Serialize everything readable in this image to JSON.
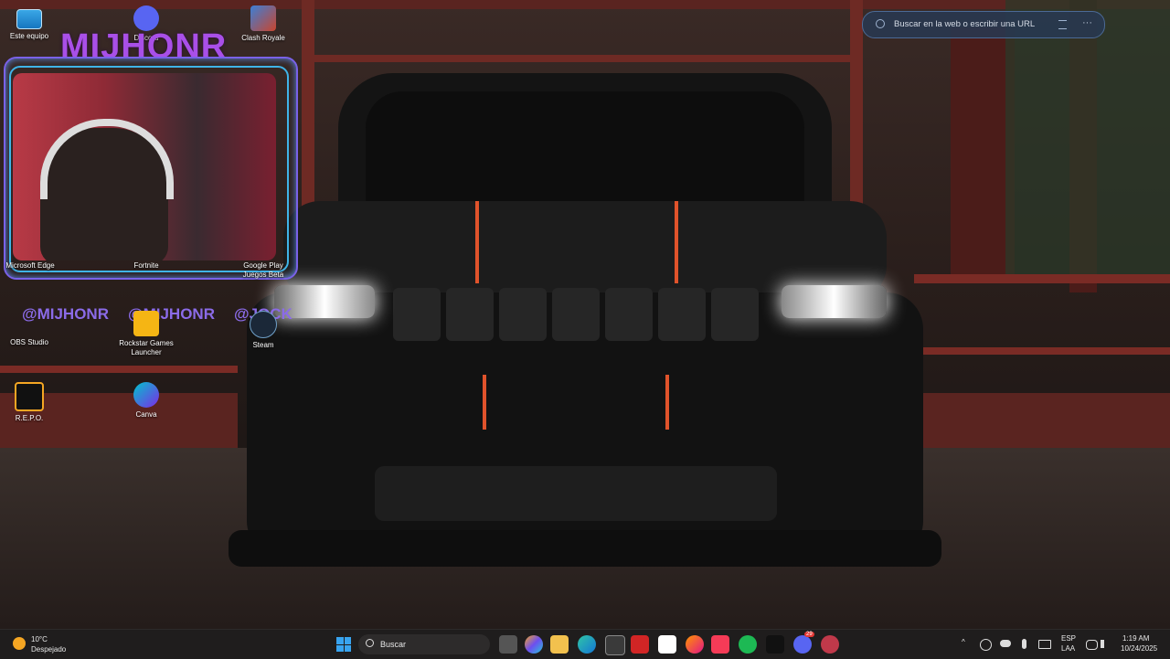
{
  "desktop": {
    "icons": [
      {
        "label": "Este equipo"
      },
      {
        "label": "Discord"
      },
      {
        "label": "Clash Royale"
      },
      {
        "label": "Microsoft Edge"
      },
      {
        "label": "Fortnite"
      },
      {
        "label": "Google Play Juegos Beta"
      },
      {
        "label": "OBS Studio"
      },
      {
        "label": "Rockstar Games Launcher"
      },
      {
        "label": "Steam"
      },
      {
        "label": "R.E.P.O."
      },
      {
        "label": "Canva"
      }
    ]
  },
  "overlay": {
    "title": "MIJHONR",
    "handles": [
      "@MIJHONR",
      "@MIJHONR",
      "@JOCK"
    ]
  },
  "edge_search": {
    "placeholder": "Buscar en la web o escribir una URL"
  },
  "taskbar": {
    "weather_temp": "10°C",
    "weather_desc": "Despejado",
    "search_label": "Buscar",
    "language": "ESP",
    "layout": "LAA",
    "time": "1:19 AM",
    "date": "10/24/2025",
    "discord_badge": "29"
  },
  "colors": {
    "accent": "#a94fe8",
    "taskbar_bg": "#1f1d1d"
  }
}
